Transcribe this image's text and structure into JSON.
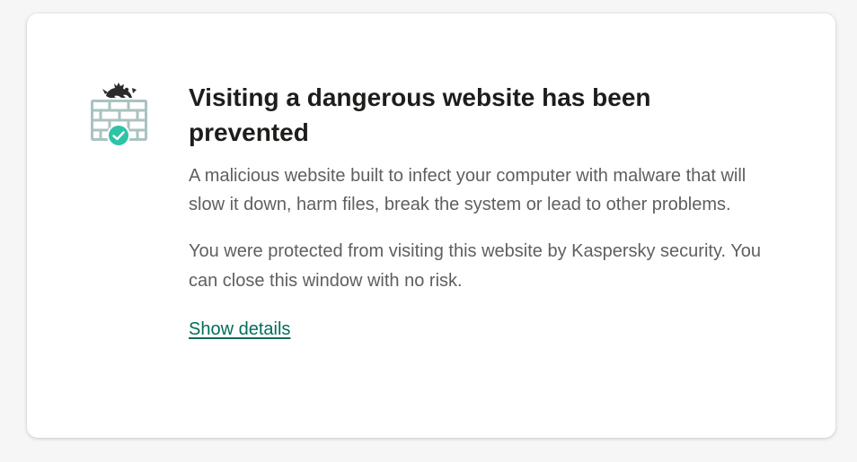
{
  "dialog": {
    "title": "Visiting a dangerous website has been prevented",
    "description": "A malicious website built to infect your computer with malware that will slow it down, harm files, break the system or lead to other problems.",
    "protection_text": "You were protected from visiting this website by Kaspersky security. You can close this window with no risk.",
    "details_link": "Show details",
    "icon": "firewall-shield-check-icon"
  },
  "colors": {
    "link": "#006d5b",
    "check_badge": "#2fc3a6",
    "wall": "#a9c3c1",
    "creature": "#2b2b2b",
    "body_text": "#5f5f5f",
    "title_text": "#1d1d1b"
  }
}
